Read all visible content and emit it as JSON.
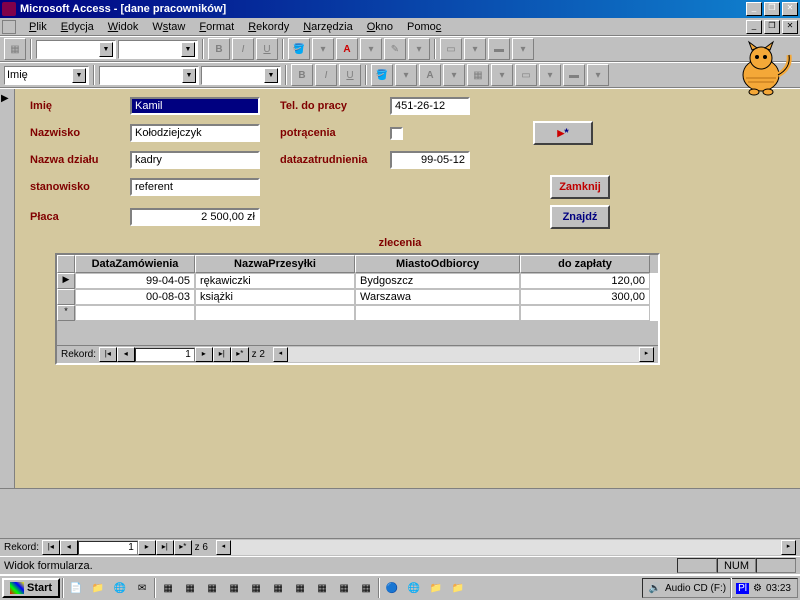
{
  "app": {
    "title": "Microsoft Access - [dane pracowników]"
  },
  "menu": [
    "Plik",
    "Edycja",
    "Widok",
    "Wstaw",
    "Format",
    "Rekordy",
    "Narzędzia",
    "Okno",
    "Pomoc"
  ],
  "combo1": "Imię",
  "form": {
    "labels": {
      "imie": "Imię",
      "nazwisko": "Nazwisko",
      "nazwa_dzialu": "Nazwa działu",
      "stanowisko": "stanowisko",
      "placa": "Płaca",
      "tel": "Tel. do pracy",
      "potracenia": "potrącenia",
      "datazatr": "datazatrudnienia"
    },
    "values": {
      "imie": "Kamil",
      "nazwisko": "Kołodziejczyk",
      "nazwa_dzialu": "kadry",
      "stanowisko": "referent",
      "placa": "2 500,00 zł",
      "tel": "451-26-12",
      "datazatr": "99-05-12"
    },
    "buttons": {
      "new": "▸*",
      "zamknij": "Zamknij",
      "znajdz": "Znajdź"
    },
    "sub_title": "zlecenia"
  },
  "grid": {
    "headers": [
      "DataZamówienia",
      "NazwaPrzesyłki",
      "MiastoOdbiorcy",
      "do zapłaty"
    ],
    "rows": [
      {
        "data": "99-04-05",
        "nazwa": "rękawiczki",
        "miasto": "Bydgoszcz",
        "zaplaty": "120,00"
      },
      {
        "data": "00-08-03",
        "nazwa": "książki",
        "miasto": "Warszawa",
        "zaplaty": "300,00"
      }
    ]
  },
  "subnav": {
    "label": "Rekord:",
    "pos": "1",
    "total": "z  2"
  },
  "mainnav": {
    "label": "Rekord:",
    "pos": "1",
    "total": "z  6"
  },
  "status": {
    "text": "Widok formularza.",
    "num": "NUM"
  },
  "taskbar": {
    "start": "Start",
    "tray_text": "Audio CD (F:)",
    "clock": "03:23"
  }
}
